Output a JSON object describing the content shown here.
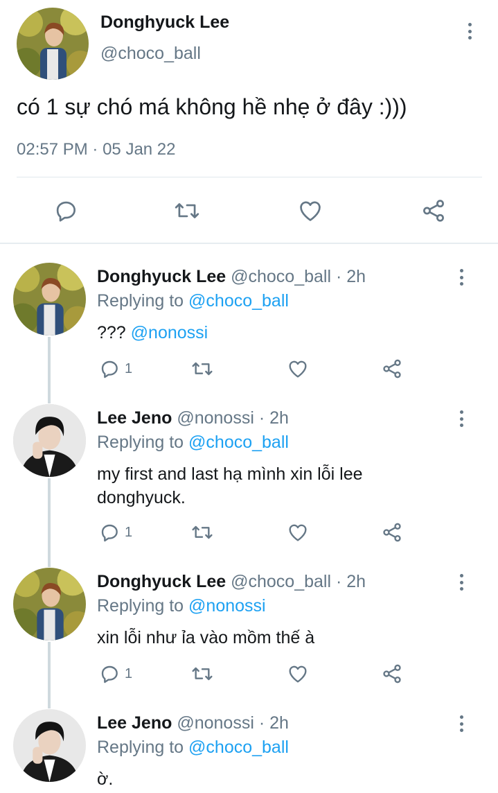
{
  "tweet": {
    "name": "Donghyuck Lee",
    "handle": "@choco_ball",
    "text": "có 1 sự chó má không hề nhẹ ở đây :)))",
    "time": "02:57 PM",
    "separator": "·",
    "date": "05 Jan 22"
  },
  "replies": [
    {
      "name": "Donghyuck Lee",
      "handle": "@choco_ball",
      "dot": "·",
      "age": "2h",
      "replying_prefix": "Replying to",
      "replying_to": "@choco_ball",
      "text": "???",
      "text_mention": "@nonossi",
      "reply_count": "1",
      "avatar": "brown-hair-outdoor-avatar"
    },
    {
      "name": "Lee Jeno",
      "handle": "@nonossi",
      "dot": "·",
      "age": "2h",
      "replying_prefix": "Replying to",
      "replying_to": "@choco_ball",
      "text": "my first and last hạ mình xin lỗi lee donghyuck.",
      "text_mention": "",
      "reply_count": "1",
      "avatar": "black-hair-suit-avatar"
    },
    {
      "name": "Donghyuck Lee",
      "handle": "@choco_ball",
      "dot": "·",
      "age": "2h",
      "replying_prefix": "Replying to",
      "replying_to": "@nonossi",
      "text": "xin lỗi như ỉa vào mồm thế à",
      "text_mention": "",
      "reply_count": "1",
      "avatar": "brown-hair-outdoor-avatar"
    },
    {
      "name": "Lee Jeno",
      "handle": "@nonossi",
      "dot": "·",
      "age": "2h",
      "replying_prefix": "Replying to",
      "replying_to": "@choco_ball",
      "text": "ờ.",
      "text_mention": "",
      "avatar": "black-hair-suit-avatar"
    }
  ],
  "icons": {
    "reply": "reply-icon",
    "retweet": "retweet-icon",
    "like": "like-icon",
    "share": "share-icon",
    "more": "more-options-icon"
  },
  "colors": {
    "link": "#1da1f2",
    "secondary_text": "#657786",
    "icon": "#657786",
    "thread_line": "#cfd9de"
  }
}
